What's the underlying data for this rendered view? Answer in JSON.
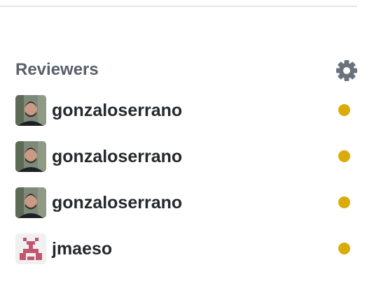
{
  "sidebar": {
    "reviewers": {
      "title": "Reviewers",
      "settings_icon": "gear-icon",
      "status_color": "#dbab0a",
      "items": [
        {
          "name": "gonzaloserrano",
          "avatar": "photo-avatar",
          "status": "pending"
        },
        {
          "name": "gonzaloserrano",
          "avatar": "photo-avatar",
          "status": "pending"
        },
        {
          "name": "gonzaloserrano",
          "avatar": "photo-avatar",
          "status": "pending"
        },
        {
          "name": "jmaeso",
          "avatar": "identicon-avatar",
          "status": "pending"
        }
      ]
    }
  }
}
